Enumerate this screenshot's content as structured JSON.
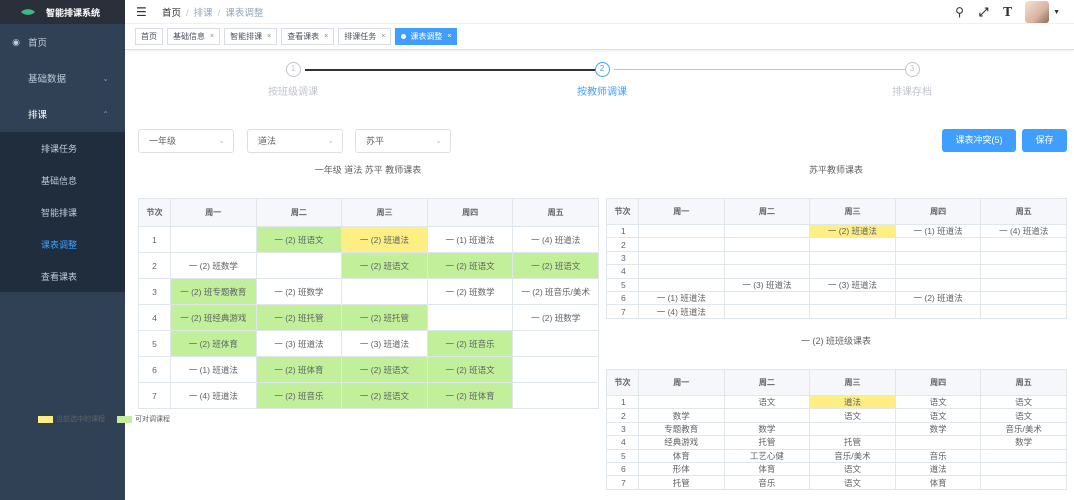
{
  "app": {
    "title": "智能排课系统"
  },
  "sidebar": {
    "items": [
      {
        "label": "首页",
        "icon": "dashboard-icon"
      },
      {
        "label": "基础数据",
        "icon": ""
      },
      {
        "label": "排课",
        "icon": ""
      }
    ],
    "submenu": [
      {
        "label": "排课任务"
      },
      {
        "label": "基础信息"
      },
      {
        "label": "智能排课"
      },
      {
        "label": "课表调整"
      },
      {
        "label": "查看课表"
      }
    ]
  },
  "breadcrumb": {
    "items": [
      "首页",
      "排课",
      "课表调整"
    ]
  },
  "tags": [
    {
      "label": "首页"
    },
    {
      "label": "基础信息"
    },
    {
      "label": "智能排课"
    },
    {
      "label": "查看课表"
    },
    {
      "label": "排课任务"
    },
    {
      "label": "课表调整"
    }
  ],
  "steps": [
    {
      "num": "1",
      "label": "按班级调课"
    },
    {
      "num": "2",
      "label": "按教师调课"
    },
    {
      "num": "3",
      "label": "排课存档"
    }
  ],
  "filters": {
    "grade": "一年级",
    "subject": "道法",
    "teacher": "苏平"
  },
  "buttons": {
    "conflict": "课表冲突(5)",
    "save": "保存"
  },
  "captions": {
    "left": "一年级 道法 苏平 教师课表",
    "right_top": "苏平教师课表",
    "right_bottom": "一 (2) 班班级课表"
  },
  "headers": [
    "节次",
    "周一",
    "周二",
    "周三",
    "周四",
    "周五"
  ],
  "teacher_table": {
    "rows": [
      {
        "period": "1",
        "cells": [
          "",
          "一 (2) 班语文",
          "一 (2) 班道法",
          "一 (1) 班道法",
          "一 (4) 班道法"
        ],
        "hl": [
          "",
          "green",
          "yellow",
          "",
          ""
        ]
      },
      {
        "period": "2",
        "cells": [
          "一 (2) 班数学",
          "",
          "一 (2) 班语文",
          "一 (2) 班语文",
          "一 (2) 班语文"
        ],
        "hl": [
          "",
          "",
          "green",
          "green",
          "green"
        ]
      },
      {
        "period": "3",
        "cells": [
          "一 (2) 班专题教育",
          "一 (2) 班数学",
          "",
          "一 (2) 班数学",
          "一 (2) 班音乐/美术"
        ],
        "hl": [
          "green",
          "",
          "",
          "",
          ""
        ]
      },
      {
        "period": "4",
        "cells": [
          "一 (2) 班经典游戏",
          "一 (2) 班托管",
          "一 (2) 班托管",
          "",
          "一 (2) 班数学"
        ],
        "hl": [
          "green",
          "green",
          "green",
          "",
          ""
        ]
      },
      {
        "period": "5",
        "cells": [
          "一 (2) 班体育",
          "一 (3) 班道法",
          "一 (3) 班道法",
          "一 (2) 班音乐",
          ""
        ],
        "hl": [
          "green",
          "",
          "",
          "green",
          ""
        ]
      },
      {
        "period": "6",
        "cells": [
          "一 (1) 班道法",
          "一 (2) 班体育",
          "一 (2) 班语文",
          "一 (2) 班语文",
          ""
        ],
        "hl": [
          "",
          "green",
          "green",
          "green",
          ""
        ]
      },
      {
        "period": "7",
        "cells": [
          "一 (4) 班道法",
          "一 (2) 班音乐",
          "一 (2) 班语文",
          "一 (2) 班体育",
          ""
        ],
        "hl": [
          "",
          "green",
          "green",
          "green",
          ""
        ]
      }
    ]
  },
  "legend": {
    "current": "当前选中的课程",
    "swappable": "可对调课程",
    "yellow": "#fdef84",
    "green": "#c2f09a"
  },
  "right_teacher_table": {
    "rows": [
      {
        "period": "1",
        "cells": [
          "",
          "",
          "一 (2) 班道法",
          "一 (1) 班道法",
          "一 (4) 班道法"
        ],
        "hl": [
          "",
          "",
          "yellow",
          "",
          ""
        ]
      },
      {
        "period": "2",
        "cells": [
          "",
          "",
          "",
          "",
          ""
        ],
        "hl": [
          "",
          "",
          "",
          "",
          ""
        ]
      },
      {
        "period": "3",
        "cells": [
          "",
          "",
          "",
          "",
          ""
        ],
        "hl": [
          "",
          "",
          "",
          "",
          ""
        ]
      },
      {
        "period": "4",
        "cells": [
          "",
          "",
          "",
          "",
          ""
        ],
        "hl": [
          "",
          "",
          "",
          "",
          ""
        ]
      },
      {
        "period": "5",
        "cells": [
          "",
          "一 (3) 班道法",
          "一 (3) 班道法",
          "",
          ""
        ],
        "hl": [
          "",
          "",
          "",
          "",
          ""
        ]
      },
      {
        "period": "6",
        "cells": [
          "一 (1) 班道法",
          "",
          "",
          "一 (2) 班道法",
          ""
        ],
        "hl": [
          "",
          "",
          "",
          "",
          ""
        ]
      },
      {
        "period": "7",
        "cells": [
          "一 (4) 班道法",
          "",
          "",
          "",
          ""
        ],
        "hl": [
          "",
          "",
          "",
          "",
          ""
        ]
      }
    ]
  },
  "right_class_table": {
    "rows": [
      {
        "period": "1",
        "cells": [
          "",
          "语文",
          "道法",
          "语文",
          "语文"
        ],
        "hl": [
          "",
          "",
          "yellow",
          "",
          ""
        ]
      },
      {
        "period": "2",
        "cells": [
          "数学",
          "",
          "语文",
          "语文",
          "语文"
        ],
        "hl": [
          "",
          "",
          "",
          "",
          ""
        ]
      },
      {
        "period": "3",
        "cells": [
          "专题教育",
          "数学",
          "",
          "数学",
          "音乐/美术"
        ],
        "hl": [
          "",
          "",
          "",
          "",
          ""
        ]
      },
      {
        "period": "4",
        "cells": [
          "经典游戏",
          "托管",
          "托管",
          "",
          "数学"
        ],
        "hl": [
          "",
          "",
          "",
          "",
          ""
        ]
      },
      {
        "period": "5",
        "cells": [
          "体育",
          "工艺心健",
          "音乐/美术",
          "音乐",
          ""
        ],
        "hl": [
          "",
          "",
          "",
          "",
          ""
        ]
      },
      {
        "period": "6",
        "cells": [
          "形体",
          "体育",
          "语文",
          "道法",
          ""
        ],
        "hl": [
          "",
          "",
          "",
          "",
          ""
        ]
      },
      {
        "period": "7",
        "cells": [
          "托管",
          "音乐",
          "语文",
          "体育",
          ""
        ],
        "hl": [
          "",
          "",
          "",
          "",
          ""
        ]
      }
    ]
  }
}
